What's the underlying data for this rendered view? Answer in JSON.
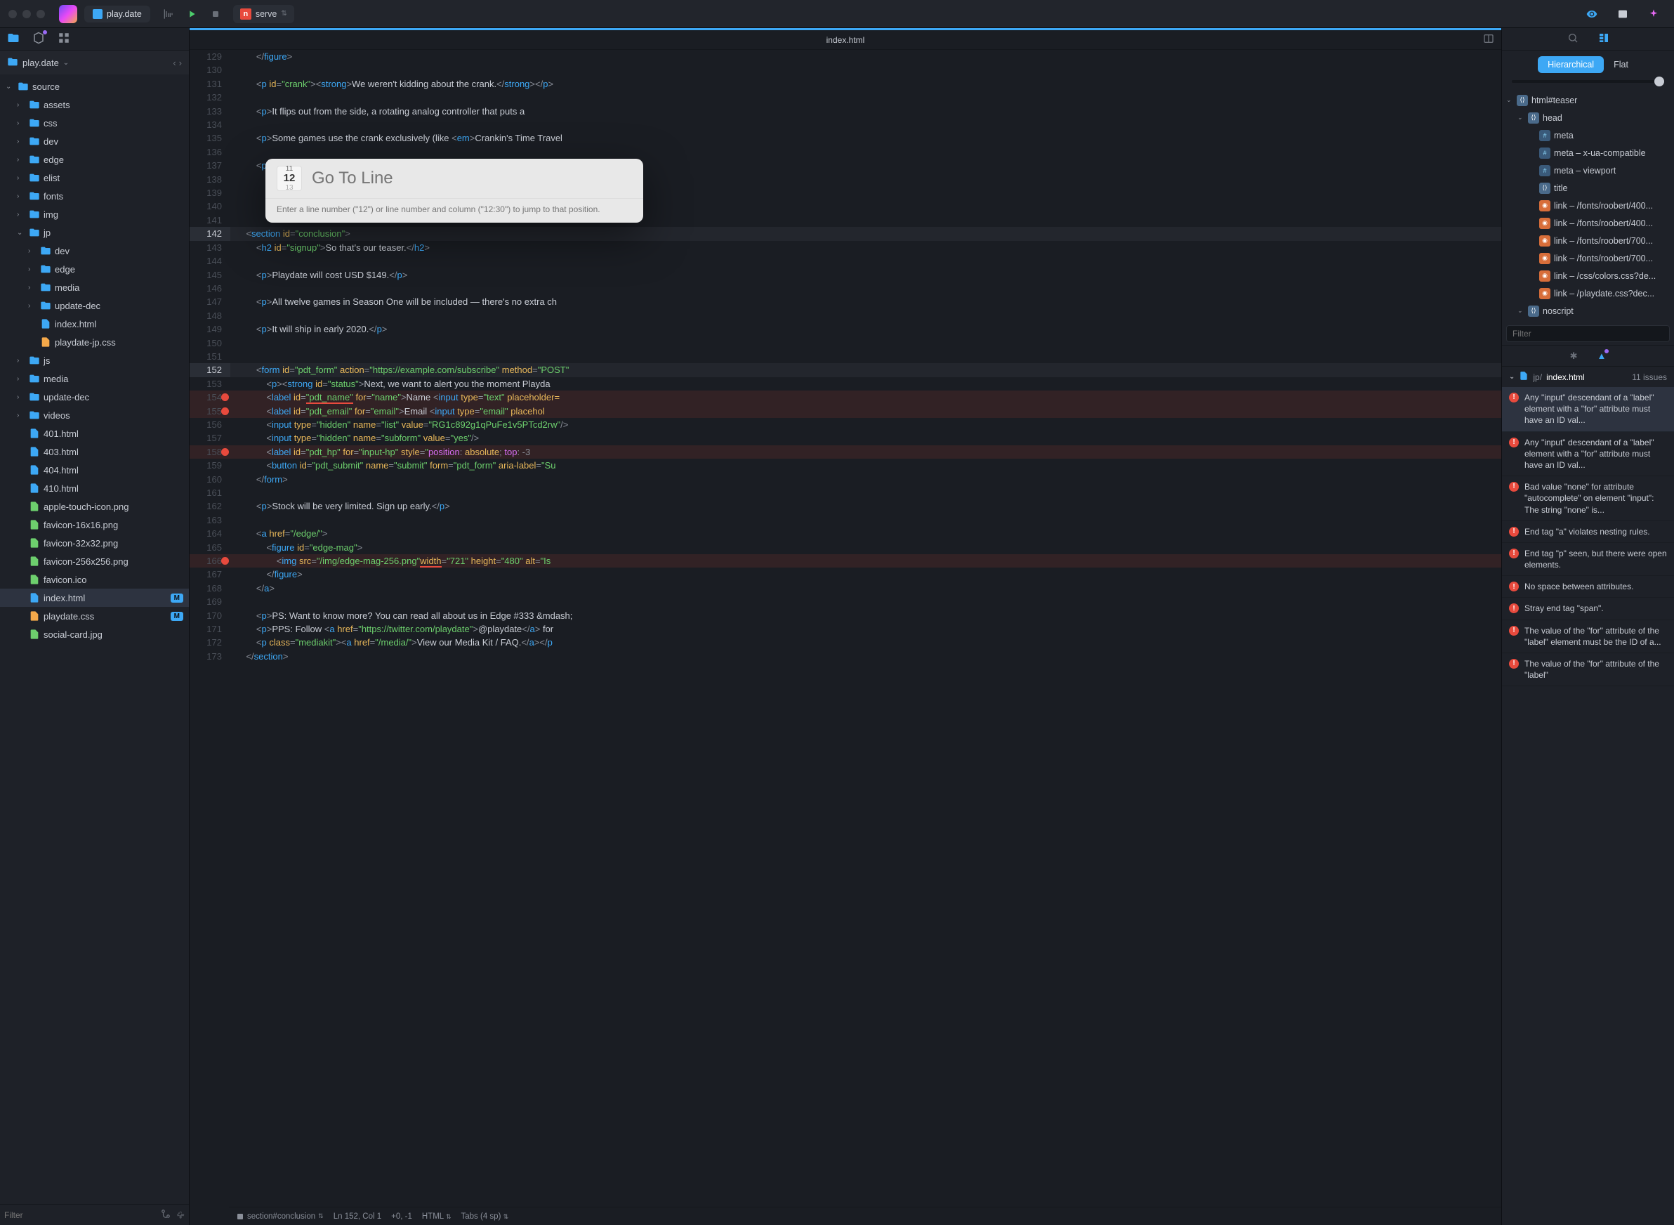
{
  "titlebar": {
    "tab_label": "play.date",
    "run_config": "serve"
  },
  "project": {
    "name": "play.date"
  },
  "tree": [
    {
      "d": 0,
      "open": true,
      "type": "folder",
      "label": "source"
    },
    {
      "d": 1,
      "open": false,
      "type": "folder",
      "label": "assets"
    },
    {
      "d": 1,
      "open": false,
      "type": "folder",
      "label": "css"
    },
    {
      "d": 1,
      "open": false,
      "type": "folder",
      "label": "dev"
    },
    {
      "d": 1,
      "open": false,
      "type": "folder",
      "label": "edge"
    },
    {
      "d": 1,
      "open": false,
      "type": "folder",
      "label": "elist"
    },
    {
      "d": 1,
      "open": false,
      "type": "folder",
      "label": "fonts"
    },
    {
      "d": 1,
      "open": false,
      "type": "folder",
      "label": "img"
    },
    {
      "d": 1,
      "open": true,
      "type": "folder",
      "label": "jp"
    },
    {
      "d": 2,
      "open": false,
      "type": "folder",
      "label": "dev"
    },
    {
      "d": 2,
      "open": false,
      "type": "folder",
      "label": "edge"
    },
    {
      "d": 2,
      "open": false,
      "type": "folder",
      "label": "media"
    },
    {
      "d": 2,
      "open": false,
      "type": "folder",
      "label": "update-dec"
    },
    {
      "d": 2,
      "type": "html",
      "label": "index.html"
    },
    {
      "d": 2,
      "type": "css",
      "label": "playdate-jp.css"
    },
    {
      "d": 1,
      "open": false,
      "type": "folder",
      "label": "js"
    },
    {
      "d": 1,
      "open": false,
      "type": "folder",
      "label": "media"
    },
    {
      "d": 1,
      "open": false,
      "type": "folder",
      "label": "update-dec"
    },
    {
      "d": 1,
      "open": false,
      "type": "folder",
      "label": "videos"
    },
    {
      "d": 1,
      "type": "html",
      "label": "401.html"
    },
    {
      "d": 1,
      "type": "html",
      "label": "403.html"
    },
    {
      "d": 1,
      "type": "html",
      "label": "404.html"
    },
    {
      "d": 1,
      "type": "html",
      "label": "410.html"
    },
    {
      "d": 1,
      "type": "img",
      "label": "apple-touch-icon.png"
    },
    {
      "d": 1,
      "type": "img",
      "label": "favicon-16x16.png"
    },
    {
      "d": 1,
      "type": "img",
      "label": "favicon-32x32.png"
    },
    {
      "d": 1,
      "type": "img",
      "label": "favicon-256x256.png"
    },
    {
      "d": 1,
      "type": "img",
      "label": "favicon.ico"
    },
    {
      "d": 1,
      "type": "html",
      "label": "index.html",
      "selected": true,
      "badge": "M"
    },
    {
      "d": 1,
      "type": "css",
      "label": "playdate.css",
      "badge": "M"
    },
    {
      "d": 1,
      "type": "img",
      "label": "social-card.jpg"
    }
  ],
  "filter_placeholder": "Filter",
  "editor": {
    "filename": "index.html",
    "first_line": 129,
    "goto": {
      "placeholder": "Go To Line",
      "hint": "Enter a line number (\"12\") or line number and column (\"12:30\") to jump to that position.",
      "icon_small1": "11",
      "icon_big": "12",
      "icon_small2": "13"
    }
  },
  "status": {
    "breadcrumb": "section#conclusion",
    "position": "Ln 152, Col 1",
    "offset": "+0, -1",
    "lang": "HTML",
    "indent": "Tabs (4 sp)"
  },
  "inspector": {
    "mode_hierarchical": "Hierarchical",
    "mode_flat": "Flat",
    "dom": [
      {
        "d": 0,
        "open": true,
        "ico": "el",
        "label": "html#teaser"
      },
      {
        "d": 1,
        "open": true,
        "ico": "el",
        "label": "head"
      },
      {
        "d": 2,
        "ico": "meta",
        "label": "meta"
      },
      {
        "d": 2,
        "ico": "meta",
        "label": "meta – x-ua-compatible"
      },
      {
        "d": 2,
        "ico": "meta",
        "label": "meta – viewport"
      },
      {
        "d": 2,
        "ico": "el",
        "label": "title"
      },
      {
        "d": 2,
        "ico": "link",
        "label": "link – /fonts/roobert/400..."
      },
      {
        "d": 2,
        "ico": "link",
        "label": "link – /fonts/roobert/400..."
      },
      {
        "d": 2,
        "ico": "link",
        "label": "link – /fonts/roobert/700..."
      },
      {
        "d": 2,
        "ico": "link",
        "label": "link – /fonts/roobert/700..."
      },
      {
        "d": 2,
        "ico": "link",
        "label": "link – /css/colors.css?de..."
      },
      {
        "d": 2,
        "ico": "link",
        "label": "link – /playdate.css?dec..."
      },
      {
        "d": 1,
        "open": true,
        "ico": "el",
        "label": "noscript"
      }
    ],
    "dom_filter_placeholder": "Filter",
    "issues_path": "jp/",
    "issues_file": "index.html",
    "issues_count": "11 issues",
    "issues": [
      {
        "msg": "Any \"input\" descendant of a \"label\" element with a \"for\" attribute must have an ID val...",
        "selected": true
      },
      {
        "msg": "Any \"input\" descendant of a \"label\" element with a \"for\" attribute must have an ID val..."
      },
      {
        "msg": "Bad value \"none\" for attribute \"autocomplete\" on element \"input\": The string \"none\" is..."
      },
      {
        "msg": "End tag \"a\" violates nesting rules."
      },
      {
        "msg": "End tag \"p\" seen, but there were open elements."
      },
      {
        "msg": "No space between attributes."
      },
      {
        "msg": "Stray end tag \"span\"."
      },
      {
        "msg": "The value of the \"for\" attribute of the \"label\" element must be the ID of a..."
      },
      {
        "msg": "The value of the \"for\" attribute of the \"label\""
      }
    ]
  }
}
